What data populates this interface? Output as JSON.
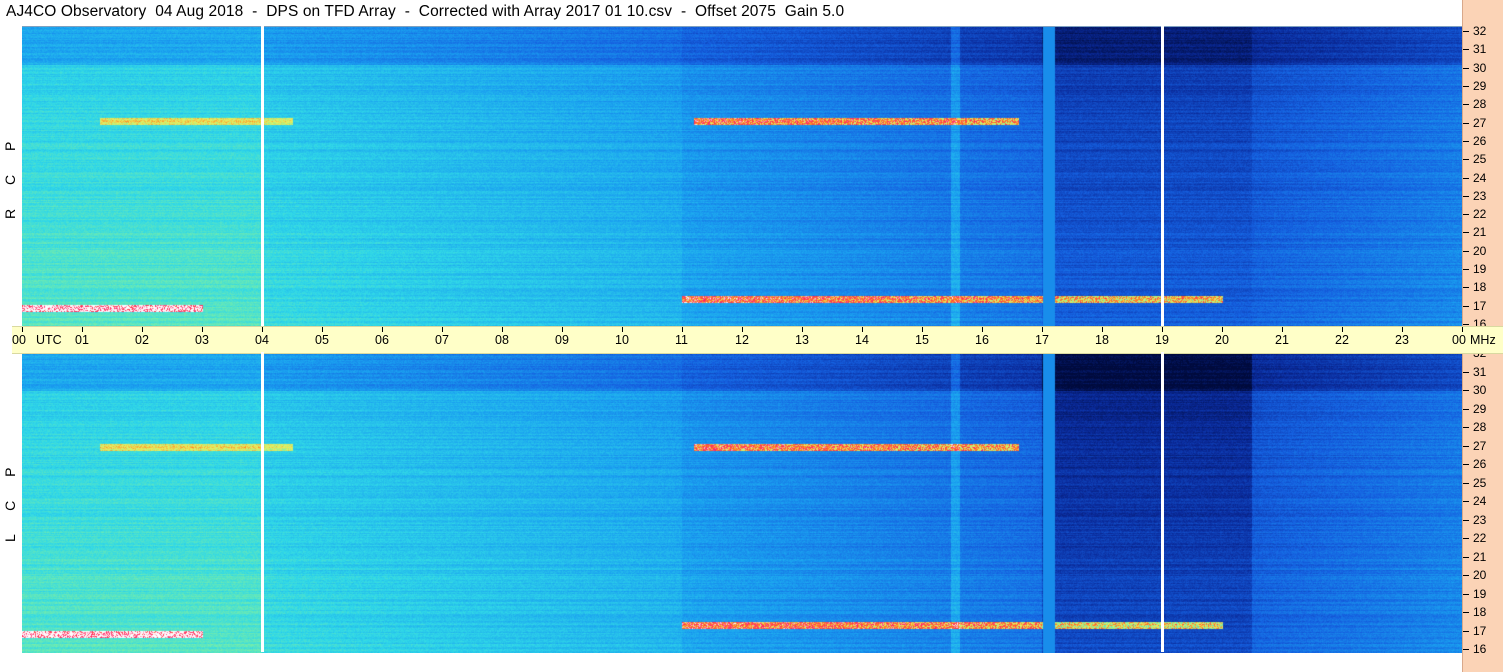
{
  "header": {
    "title": "AJ4CO Observatory  04 Aug 2018  -  DPS on TFD Array  -  Corrected with Array 2017 01 10.csv  -  Offset 2075  Gain 5.0"
  },
  "panels": [
    {
      "polarization": "R C P"
    },
    {
      "polarization": "L C P"
    }
  ],
  "colors": {
    "freq_scale_bg": "#fbd3b6",
    "time_axis_bg": "#ffffc8",
    "marker_line": "#ffffff",
    "colormap": [
      "#000a3c",
      "#0a2a9a",
      "#1560e0",
      "#1aa0f0",
      "#30d8e8",
      "#80f0a0",
      "#e8f060",
      "#ff8020",
      "#ff2060",
      "#ffffff"
    ]
  },
  "chart_data": {
    "type": "heatmap",
    "title": "AJ4CO Observatory  04 Aug 2018  -  DPS on TFD Array  -  Corrected with Array 2017 01 10.csv  -  Offset 2075  Gain 5.0",
    "x_axis": {
      "unit_label": "UTC",
      "ticks": [
        "00",
        "01",
        "02",
        "03",
        "04",
        "05",
        "06",
        "07",
        "08",
        "09",
        "10",
        "11",
        "12",
        "13",
        "14",
        "15",
        "16",
        "17",
        "18",
        "19",
        "20",
        "21",
        "22",
        "23",
        "00"
      ],
      "range_hours": [
        0,
        24
      ]
    },
    "y_axis": {
      "unit_label": "MHz",
      "range_mhz": [
        16,
        32
      ],
      "ticks": [
        16,
        17,
        18,
        19,
        20,
        21,
        22,
        23,
        24,
        25,
        26,
        27,
        28,
        29,
        30,
        31,
        32
      ]
    },
    "series": [
      {
        "name": "R C P"
      },
      {
        "name": "L C P"
      }
    ],
    "time_markers_hours": [
      4,
      19
    ],
    "notable_features": [
      {
        "kind": "band",
        "freq_mhz": 27,
        "start_hour": 11.2,
        "end_hour": 16.6,
        "intensity": "high"
      },
      {
        "kind": "band",
        "freq_mhz": 17.5,
        "start_hour": 11.0,
        "end_hour": 20.0,
        "intensity": "high"
      },
      {
        "kind": "band",
        "freq_mhz": 17.0,
        "start_hour": 0.0,
        "end_hour": 3.0,
        "intensity": "high"
      },
      {
        "kind": "band",
        "freq_mhz": 27,
        "start_hour": 1.3,
        "end_hour": 4.5,
        "intensity": "medium"
      },
      {
        "kind": "column",
        "hour": 17.1,
        "intensity": "gap"
      },
      {
        "kind": "region",
        "start_hour": 17.0,
        "end_hour": 20.5,
        "intensity": "low"
      }
    ]
  }
}
